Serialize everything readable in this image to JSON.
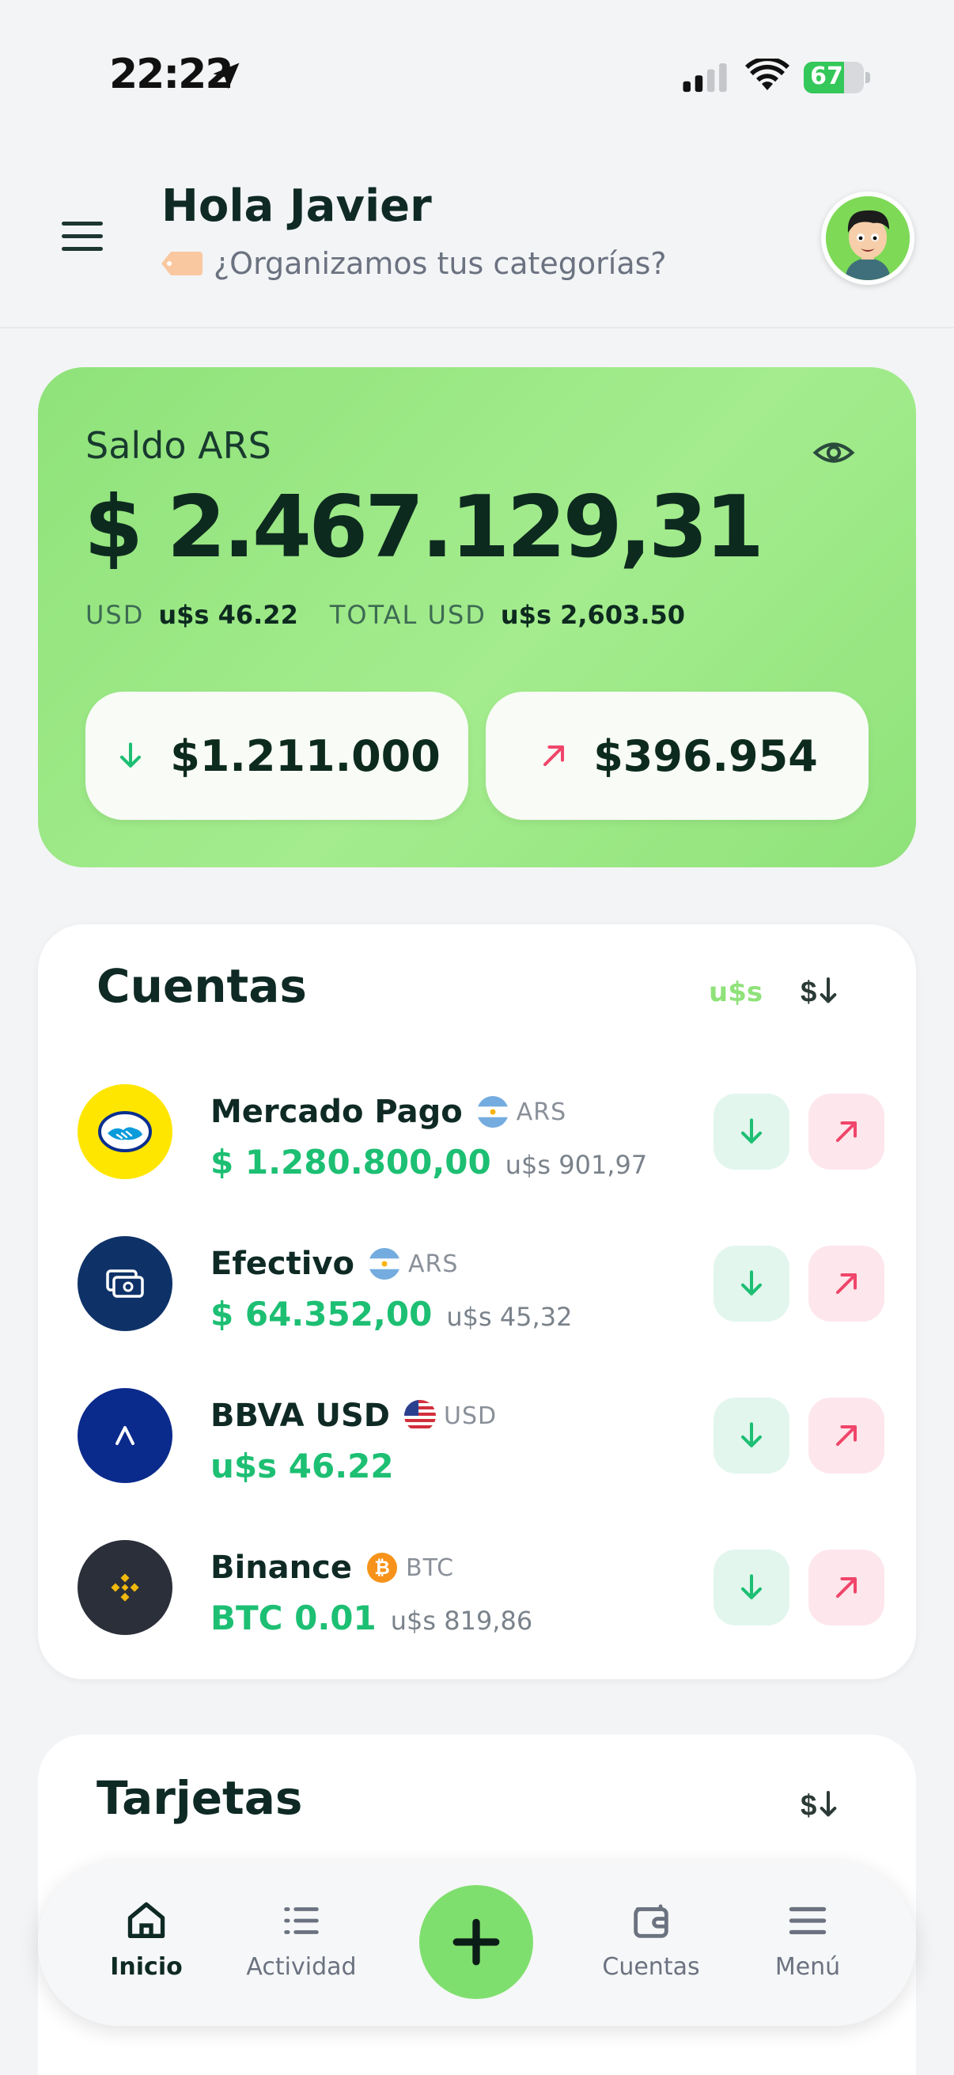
{
  "status_bar": {
    "time": "22:22",
    "battery": "67",
    "battery_level": 0.67
  },
  "header": {
    "greeting": "Hola Javier",
    "subtitle": "¿Organizamos tus categorías?"
  },
  "balance": {
    "label": "Saldo ARS",
    "amount": "$ 2.467.129,31",
    "usd_key": "USD",
    "usd_value": "u$s 46.22",
    "total_key": "TOTAL USD",
    "total_value": "u$s 2,603.50",
    "income": "$1.211.000",
    "expense": "$396.954"
  },
  "accounts": {
    "title": "Cuentas",
    "currency_toggle": "u$s",
    "items": [
      {
        "name": "Mercado Pago",
        "currency": "ARS",
        "amount": "$ 1.280.800,00",
        "usd": "u$s 901,97"
      },
      {
        "name": "Efectivo",
        "currency": "ARS",
        "amount": "$ 64.352,00",
        "usd": "u$s 45,32"
      },
      {
        "name": "BBVA USD",
        "currency": "USD",
        "amount": "u$s 46.22",
        "usd": ""
      },
      {
        "name": "Binance",
        "currency": "BTC",
        "amount": "BTC 0.01",
        "usd": "u$s 819,86"
      }
    ]
  },
  "cards": {
    "title": "Tarjetas"
  },
  "nav": {
    "items": [
      {
        "label": "Inicio"
      },
      {
        "label": "Actividad"
      },
      {
        "label": "Cuentas"
      },
      {
        "label": "Menú"
      }
    ]
  },
  "colors": {
    "accent": "#8fe27a",
    "positive": "#1dbf73",
    "negative": "#f0456a",
    "dark_text": "#0f2a24"
  },
  "icons": [
    "location-arrow-icon",
    "signal-icon",
    "wifi-icon",
    "battery-icon",
    "menu-icon",
    "tag-icon",
    "eye-icon",
    "arrow-down-icon",
    "arrow-up-right-icon",
    "sort-currency-icon",
    "home-icon",
    "list-icon",
    "plus-icon",
    "wallet-icon",
    "hamburger-icon"
  ]
}
